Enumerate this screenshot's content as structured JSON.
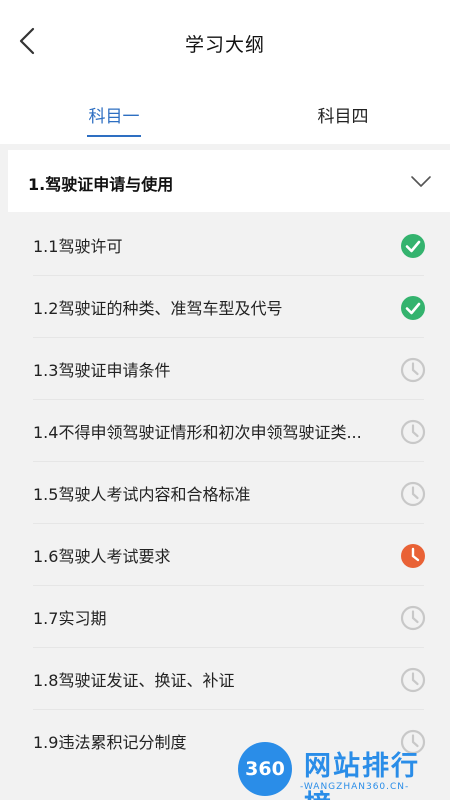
{
  "header": {
    "title": "学习大纲",
    "back_icon": "chevron-left-icon"
  },
  "tabs": [
    {
      "label": "科目一",
      "active": true
    },
    {
      "label": "科目四",
      "active": false
    }
  ],
  "colors": {
    "accent": "#2e6fc2",
    "done": "#34b36e",
    "in_progress": "#e96236",
    "pending": "#c8c8c8",
    "background": "#f2f2f2"
  },
  "section": {
    "title": "1.驾驶证申请与使用",
    "expanded": true
  },
  "items": [
    {
      "label": "1.1驾驶许可",
      "status": "done"
    },
    {
      "label": "1.2驾驶证的种类、准驾车型及代号",
      "status": "done"
    },
    {
      "label": "1.3驾驶证申请条件",
      "status": "pending"
    },
    {
      "label": "1.4不得申领驾驶证情形和初次申领驾驶证类...",
      "status": "pending"
    },
    {
      "label": "1.5驾驶人考试内容和合格标准",
      "status": "pending"
    },
    {
      "label": "1.6驾驶人考试要求",
      "status": "in_progress"
    },
    {
      "label": "1.7实习期",
      "status": "pending"
    },
    {
      "label": "1.8驾驶证发证、换证、补证",
      "status": "pending"
    },
    {
      "label": "1.9违法累积记分制度",
      "status": "pending"
    }
  ],
  "watermark": {
    "badge": "360",
    "title": "网站排行榜",
    "subtitle": "-WANGZHAN360.CN-"
  }
}
